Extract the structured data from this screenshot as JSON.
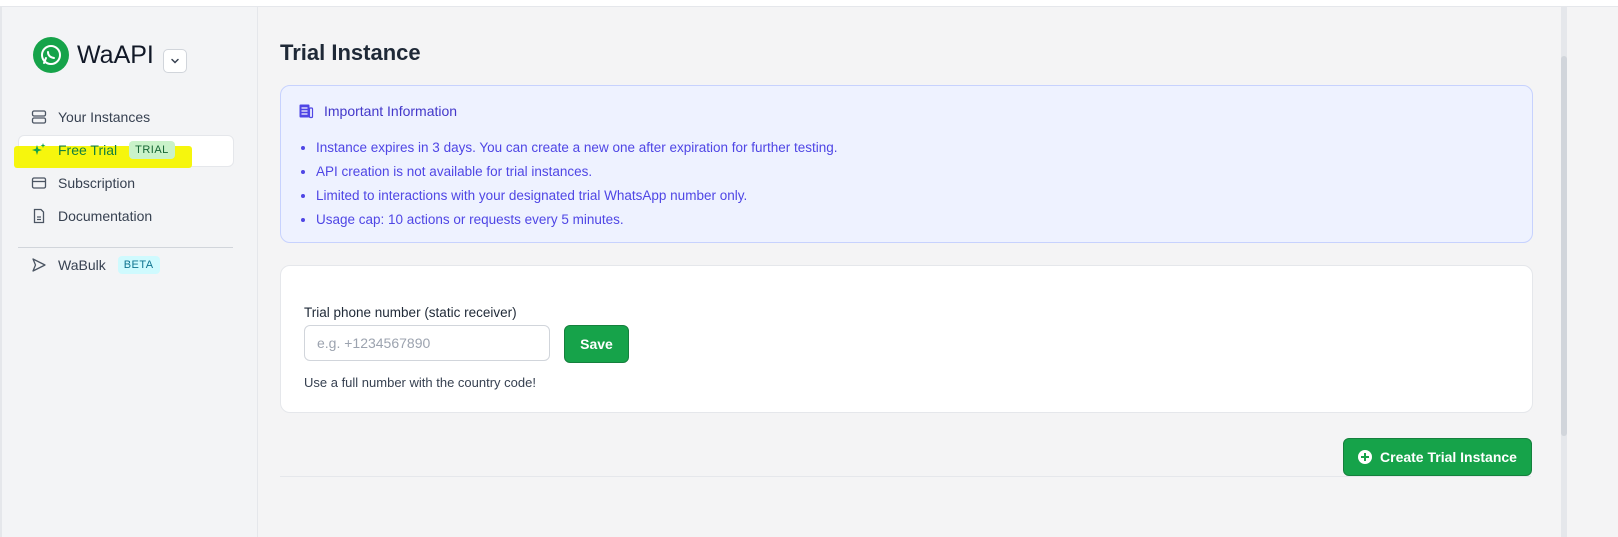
{
  "brand": {
    "name": "WaAPI",
    "logo_icon": "whatsapp-icon"
  },
  "sidebar": {
    "items": [
      {
        "label": "Your Instances",
        "icon": "server-icon"
      },
      {
        "label": "Free Trial",
        "icon": "sparkles-icon",
        "badge": "TRIAL",
        "active": true
      },
      {
        "label": "Subscription",
        "icon": "credit-card-icon"
      },
      {
        "label": "Documentation",
        "icon": "file-icon"
      },
      {
        "label": "WaBulk",
        "icon": "send-icon",
        "badge": "BETA"
      }
    ]
  },
  "main": {
    "title": "Trial Instance",
    "info": {
      "heading": "Important Information",
      "items": [
        "Instance expires in 3 days. You can create a new one after expiration for further testing.",
        "API creation is not available for trial instances.",
        "Limited to interactions with your designated trial WhatsApp number only.",
        "Usage cap: 10 actions or requests every 5 minutes."
      ]
    },
    "form": {
      "label": "Trial phone number (static receiver)",
      "placeholder": "e.g. +1234567890",
      "value": "",
      "save_label": "Save",
      "hint": "Use a full number with the country code!"
    },
    "create_label": "Create Trial Instance"
  },
  "colors": {
    "accent": "#16a34a",
    "info_bg": "#eef2ff",
    "info_text": "#4f46e5",
    "highlight": "#f5f500"
  }
}
